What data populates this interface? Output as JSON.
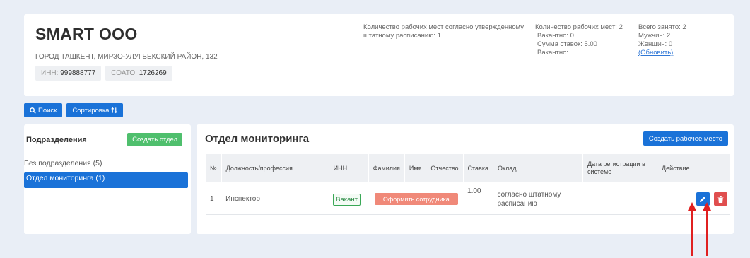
{
  "org": {
    "name": "SMART OOO",
    "address": "ГОРОД ТАШКЕНТ, МИРЗО-УЛУГБЕКСКИЙ РАЙОН, 132",
    "inn_label": "ИНН:",
    "inn_value": "999888777",
    "soato_label": "СОАТО:",
    "soato_value": "1726269"
  },
  "stats": {
    "plan_line1": "Количество рабочих мест согласно утвержденному",
    "plan_line2": "штатному расписанию: 1",
    "workplaces_line1": "Количество рабочих мест: 2",
    "workplaces_line2": "Вакантно: 0",
    "workplaces_line3": "Сумма ставок: 5.00",
    "workplaces_line4": "Вакантно:",
    "total_line1": "Всего занято: 2",
    "total_line2": "Мужчин: 2",
    "total_line3": "Женщин: 0",
    "refresh_link": "(Обновить)"
  },
  "toolbar": {
    "search_label": "Поиск",
    "sort_label": "Сортировка"
  },
  "departments": {
    "title": "Подразделения",
    "create_label": "Создать отдел",
    "items": [
      {
        "label": "Без подразделения (5)"
      },
      {
        "label": "Отдел мониторинга (1)"
      }
    ]
  },
  "main": {
    "title": "Отдел мониторинга",
    "create_workplace_label": "Создать рабочее место",
    "columns": [
      "№",
      "Должность/профессия",
      "ИНН",
      "Фамилия",
      "Имя",
      "Отчество",
      "Ставка",
      "Оклад",
      "Дата регистрации в системе",
      "Действие"
    ],
    "rows": [
      {
        "num": "1",
        "position": "Инспектор",
        "inn_badge": "Вакант",
        "hire_label": "Оформить сотрудника",
        "rate": "1.00",
        "salary": "согласно штатному расписанию",
        "reg_date": ""
      }
    ]
  },
  "colors": {
    "primary": "#1a72d8",
    "success": "#4fbf6d",
    "danger": "#e04e4e",
    "hire": "#f08979",
    "annotation_arrows": "#e02020"
  }
}
